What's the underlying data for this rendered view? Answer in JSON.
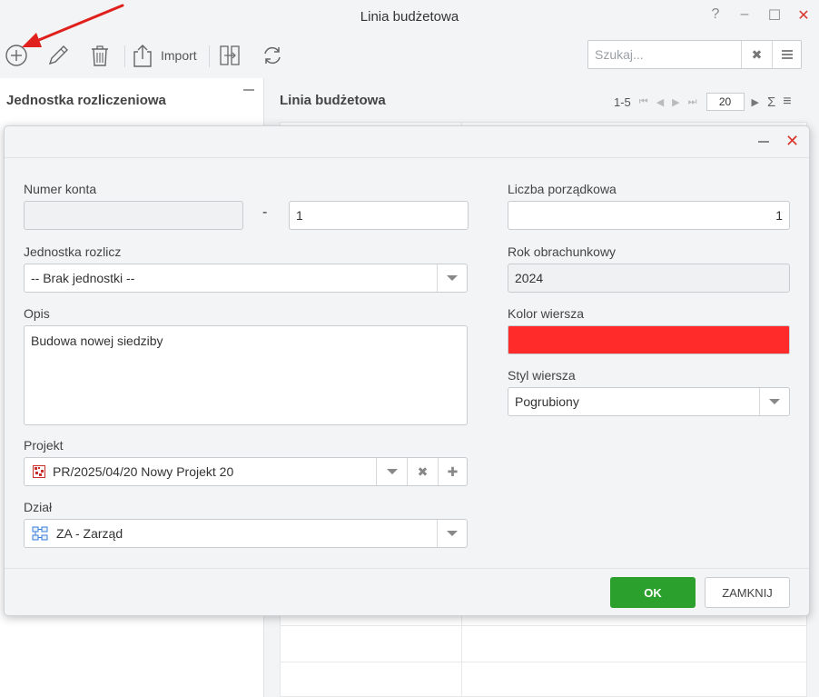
{
  "window": {
    "title": "Linia budżetowa",
    "help": "?",
    "minimize": "–",
    "maximize": "☐",
    "close": "✕"
  },
  "toolbar": {
    "import_label": "Import"
  },
  "search": {
    "placeholder": "Szukaj...",
    "clear": "✖"
  },
  "left_panel": {
    "title": "Jednostka rozliczeniowa"
  },
  "right_panel": {
    "title": "Linia budżetowa",
    "range": "1-5",
    "page_size": "20",
    "sigma": "Σ",
    "menu": "≡"
  },
  "dialog": {
    "close": "✕",
    "account_label": "Numer konta",
    "account_prefix": "",
    "account_dash": "-",
    "account_number": "1",
    "ordinal_label": "Liczba porządkowa",
    "ordinal_value": "1",
    "unit_label": "Jednostka rozlicz",
    "unit_value": "-- Brak jednostki --",
    "year_label": "Rok obrachunkowy",
    "year_value": "2024",
    "description_label": "Opis",
    "description_value": "Budowa nowej siedziby",
    "row_color_label": "Kolor wiersza",
    "row_color": "#ff2a2a",
    "row_style_label": "Styl wiersza",
    "row_style_value": "Pogrubiony",
    "project_label": "Projekt",
    "project_value": "PR/2025/04/20 Nowy Projekt 20",
    "project_clear": "✖",
    "project_add": "✚",
    "department_label": "Dział",
    "department_value": "ZA - Zarząd",
    "ok_label": "OK",
    "close_label": "ZAMKNIJ"
  },
  "colors": {
    "ok_button": "#2ca02c",
    "close_icon": "#d9382e",
    "annotation_arrow": "#e0201c"
  }
}
